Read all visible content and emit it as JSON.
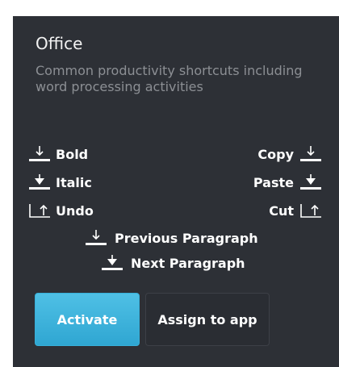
{
  "profile": {
    "title": "Office",
    "description": "Common productivity shortcuts including word processing activities"
  },
  "shortcuts": {
    "bold": "Bold",
    "italic": "Italic",
    "undo": "Undo",
    "copy": "Copy",
    "paste": "Paste",
    "cut": "Cut",
    "previous_paragraph": "Previous Paragraph",
    "next_paragraph": "Next Paragraph"
  },
  "icons": {
    "single_down": "swipe-down-one-icon",
    "double_down": "swipe-down-two-icon",
    "corner_up": "swipe-corner-up-icon"
  },
  "buttons": {
    "activate": "Activate",
    "assign": "Assign to app"
  },
  "colors": {
    "panel_bg": "#2d3036",
    "accent": "#3bb3dd",
    "muted_text": "#8c8f94"
  }
}
